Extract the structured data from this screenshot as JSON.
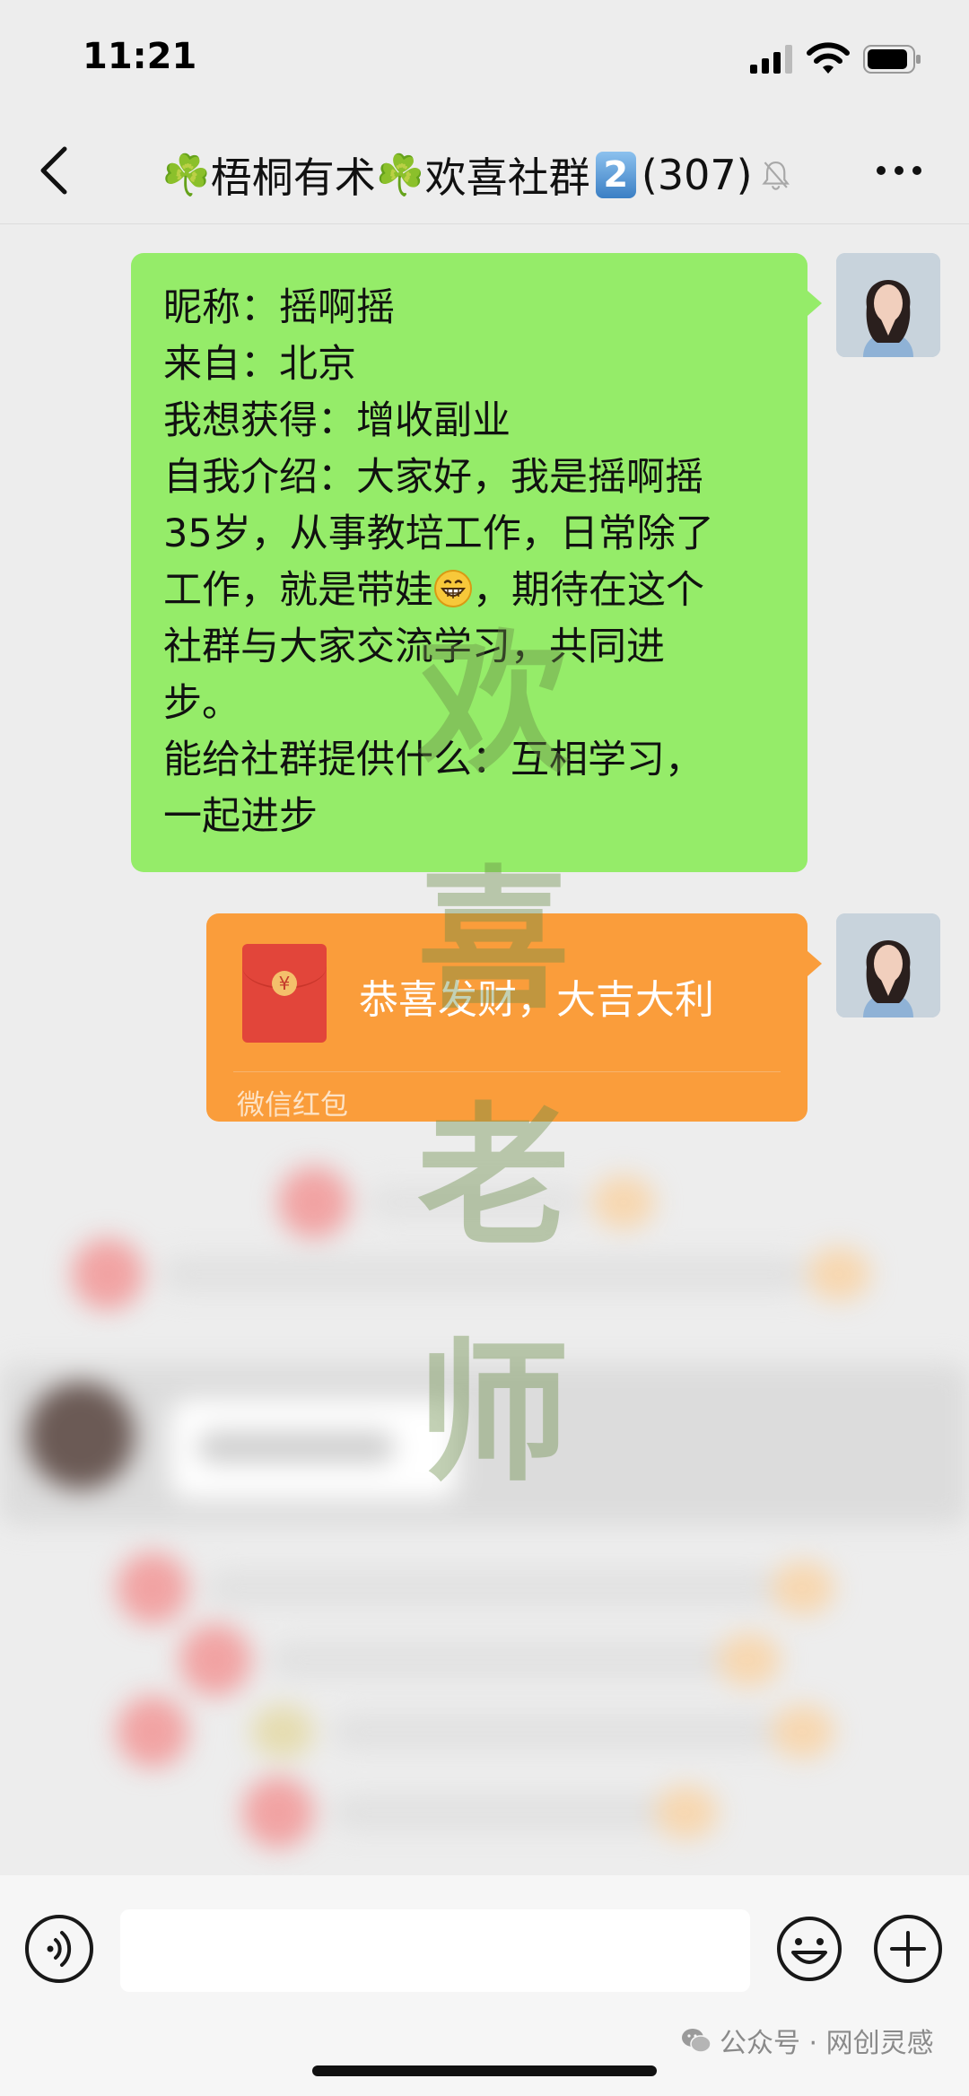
{
  "status_bar": {
    "time": "11:21"
  },
  "nav": {
    "clover": "☘️",
    "title_part1": "梧桐有术",
    "title_part2": "欢喜社群",
    "badge": "2",
    "count": "(307)"
  },
  "messages": [
    {
      "type": "text",
      "lines": [
        "昵称：摇啊摇",
        "来自：北京",
        "我想获得：增收副业",
        "自我介绍：大家好，我是摇啊摇",
        "35岁，从事教培工作，日常除了",
        "工作，就是带娃",
        "，期待在这个",
        "社群与大家交流学习，共同进",
        "步。",
        "能给社群提供什么：互相学习，",
        "一起进步"
      ]
    },
    {
      "type": "red_packet",
      "title": "恭喜发财，大吉大利",
      "coin": "¥",
      "label": "微信红包"
    }
  ],
  "watermark": [
    "欢",
    "喜",
    "老",
    "师"
  ],
  "footer": {
    "source": "公众号 · 网创灵感"
  },
  "colors": {
    "background": "#ededed",
    "green_bubble": "#95ec69",
    "red_packet": "#fa9d3b",
    "red_packet_icon": "#e2453a"
  },
  "icons": {
    "back": "chevron-left-icon",
    "mute": "bell-off-icon",
    "more": "more-dots-icon",
    "voice": "voice-icon",
    "emoji": "emoji-icon",
    "plus": "plus-icon",
    "emoji_in_text": "grinning-face-emoji"
  }
}
